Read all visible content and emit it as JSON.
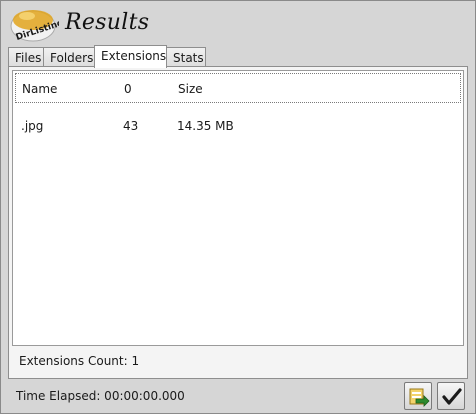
{
  "window": {
    "title": "Results",
    "logo_text": "DirListing"
  },
  "tabs": [
    {
      "label": "Files"
    },
    {
      "label": "Folders"
    },
    {
      "label": "Extensions"
    },
    {
      "label": "Stats"
    }
  ],
  "active_tab": "Extensions",
  "table": {
    "columns": [
      "Name",
      "0",
      "Size"
    ],
    "rows": [
      {
        "name": ".jpg",
        "count": "43",
        "size": "14.35 MB"
      }
    ]
  },
  "summary": {
    "extensions_count": "Extensions Count: 1"
  },
  "footer": {
    "time_elapsed": "Time Elapsed: 00:00:00.000"
  },
  "buttons": {
    "export_icon": "export-arrow-icon",
    "ok_icon": "checkmark-icon"
  },
  "colors": {
    "panel_bg": "#f4f4f4",
    "window_bg": "#d6d6d6",
    "accent_green": "#2e8b2e"
  }
}
